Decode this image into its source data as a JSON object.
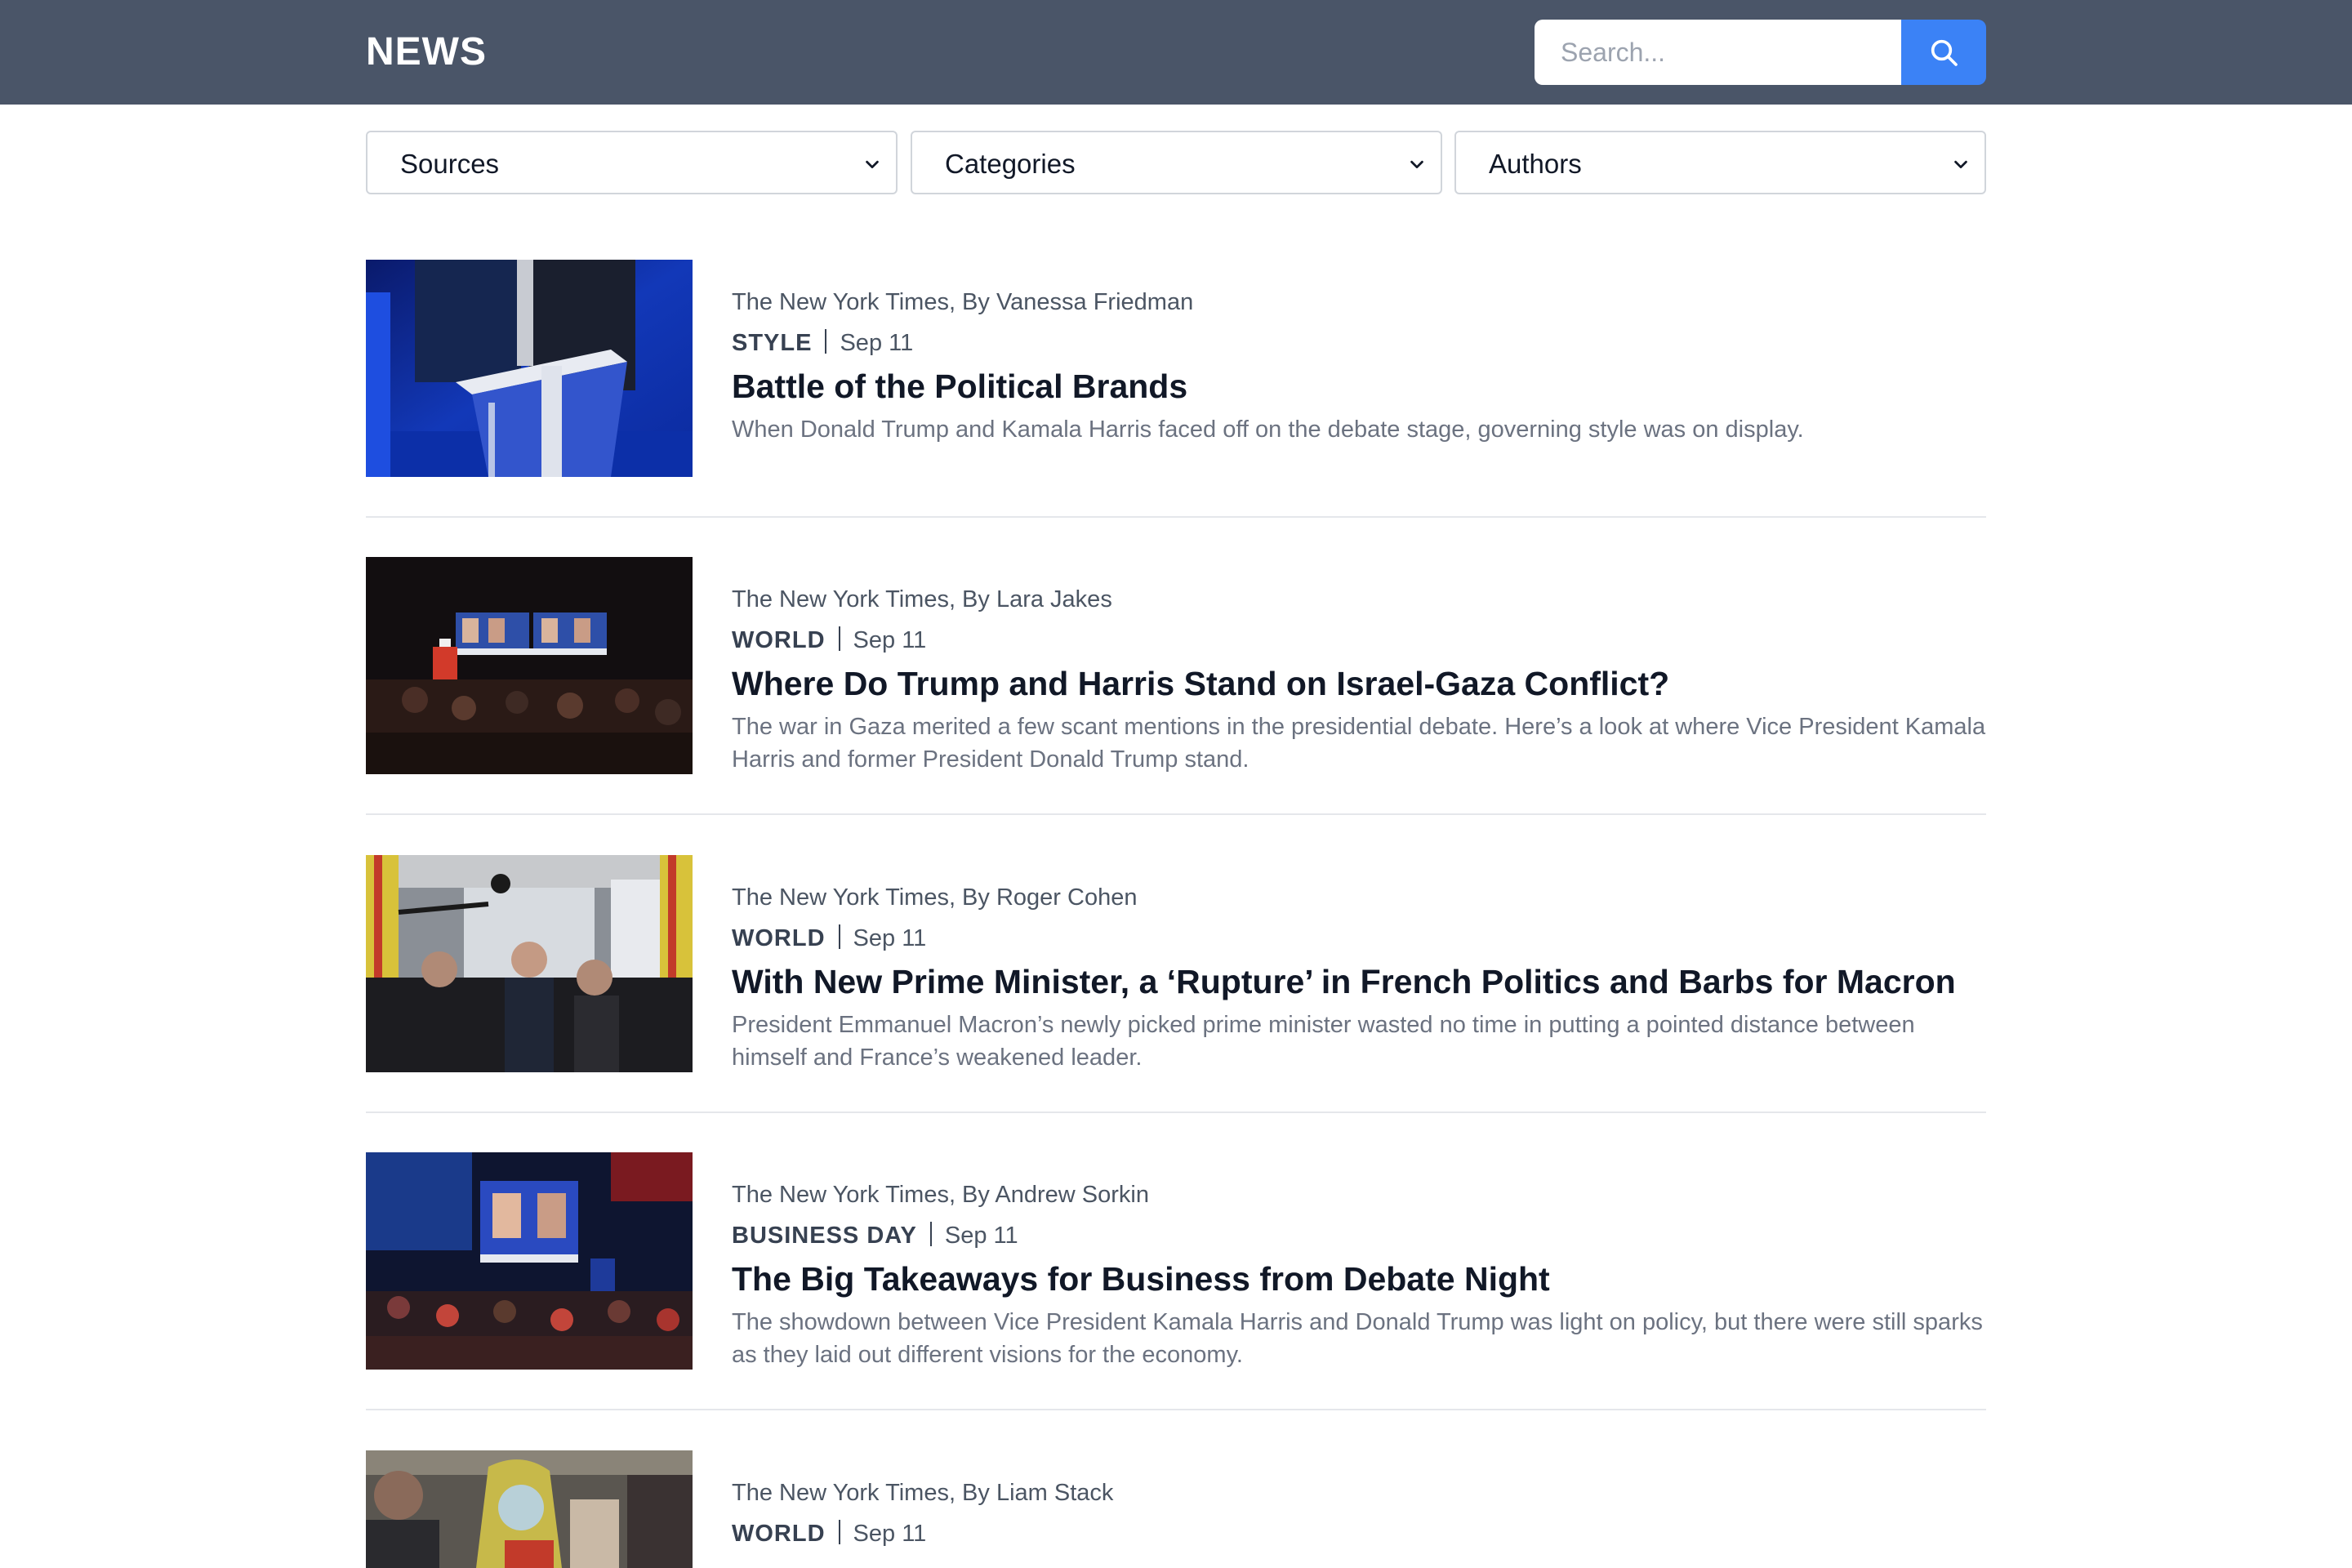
{
  "header": {
    "brand": "NEWS",
    "search": {
      "placeholder": "Search...",
      "value": ""
    }
  },
  "filters": {
    "sources": "Sources",
    "categories": "Categories",
    "authors": "Authors"
  },
  "articles": [
    {
      "byline": "The New York Times, By Vanessa Friedman",
      "category": "STYLE",
      "date": "Sep 11",
      "title": "Battle of the Political Brands",
      "description": "When Donald Trump and Kamala Harris faced off on the debate stage, governing style was on display."
    },
    {
      "byline": "The New York Times, By Lara Jakes",
      "category": "WORLD",
      "date": "Sep 11",
      "title": "Where Do Trump and Harris Stand on Israel-Gaza Conflict?",
      "description": "The war in Gaza merited a few scant mentions in the presidential debate. Here’s a look at where Vice President Kamala Harris and former President Donald Trump stand."
    },
    {
      "byline": "The New York Times, By Roger Cohen",
      "category": "WORLD",
      "date": "Sep 11",
      "title": "With New Prime Minister, a ‘Rupture’ in French Politics and Barbs for Macron",
      "description": "President Emmanuel Macron’s newly picked prime minister wasted no time in putting a pointed distance between himself and France’s weakened leader."
    },
    {
      "byline": "The New York Times, By Andrew Sorkin",
      "category": "BUSINESS DAY",
      "date": "Sep 11",
      "title": "The Big Takeaways for Business from Debate Night",
      "description": "The showdown between Vice President Kamala Harris and Donald Trump was light on policy, but there were still sparks as they laid out different visions for the economy."
    },
    {
      "byline": "The New York Times, By Liam Stack",
      "category": "WORLD",
      "date": "Sep 11",
      "title": "",
      "description": ""
    }
  ],
  "colors": {
    "header_bg": "#4a5568",
    "accent": "#3b82f6"
  },
  "icons": {
    "search": "search-icon",
    "dropdown": "chevron-down-icon"
  }
}
